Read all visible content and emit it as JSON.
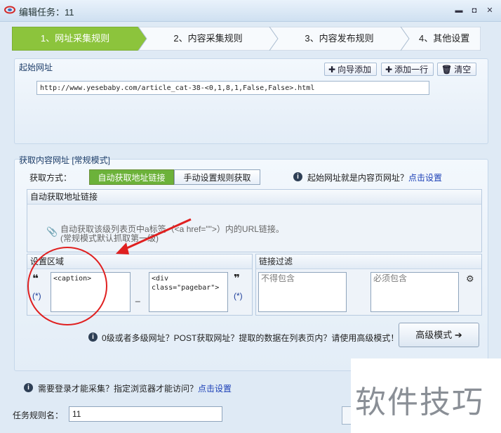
{
  "window": {
    "title": "编辑任务：11",
    "controls": [
      "minimize-icon",
      "restore-icon",
      "close-icon"
    ]
  },
  "steps": [
    {
      "label": "1、网址采集规则",
      "active": true
    },
    {
      "label": "2、内容采集规则",
      "active": false
    },
    {
      "label": "3、内容发布规则",
      "active": false
    },
    {
      "label": "4、其他设置",
      "active": false
    }
  ],
  "start_url": {
    "title": "起始网址",
    "buttons": [
      {
        "icon": "plus-icon",
        "label": "向导添加"
      },
      {
        "icon": "plus-icon",
        "label": "添加一行"
      },
      {
        "icon": "trash-icon",
        "label": "清空"
      }
    ],
    "value": "http://www.yesebaby.com/article_cat-38-<0,1,8,1,False,False>.html"
  },
  "fetch": {
    "title": "获取内容网址 [常规模式]",
    "method_label": "获取方式：",
    "tabs": [
      {
        "label": "自动获取地址链接",
        "active": true
      },
      {
        "label": "手动设置规则获取",
        "active": false
      }
    ],
    "hint_question": "起始网址就是内容页网址？",
    "hint_link": "点击设置",
    "auto_group_title": "自动获取地址链接",
    "auto_desc_line1": "自动获取该级列表页中a标签（<a href=\"\">）内的URL链接。",
    "auto_desc_line2": "(常规模式默认抓取第一级)",
    "region": {
      "title": "设置区域",
      "open_quote": "❝",
      "close_quote": "❞",
      "wildcard": "(*)",
      "start": "<caption>",
      "separator": "_",
      "end": "<div\nclass=\"pagebar\">"
    },
    "filter": {
      "title": "链接过滤",
      "exclude_placeholder": "不得包含",
      "include_placeholder": "必须包含"
    },
    "advanced_hint": "0级或者多级网址？POST获取网址？提取的数据在列表页内？请使用高级模式！",
    "advanced_button": "高级模式"
  },
  "login_hint": {
    "question": "需要登录才能采集？指定浏览器才能访问？",
    "link": "点击设置"
  },
  "task_name": {
    "label": "任务规则名：",
    "value": "11"
  },
  "watermark": "软件技巧",
  "colors": {
    "step_active": "#8cc43c",
    "tab_active": "#6cb23a",
    "annotation_red": "#e02020"
  }
}
